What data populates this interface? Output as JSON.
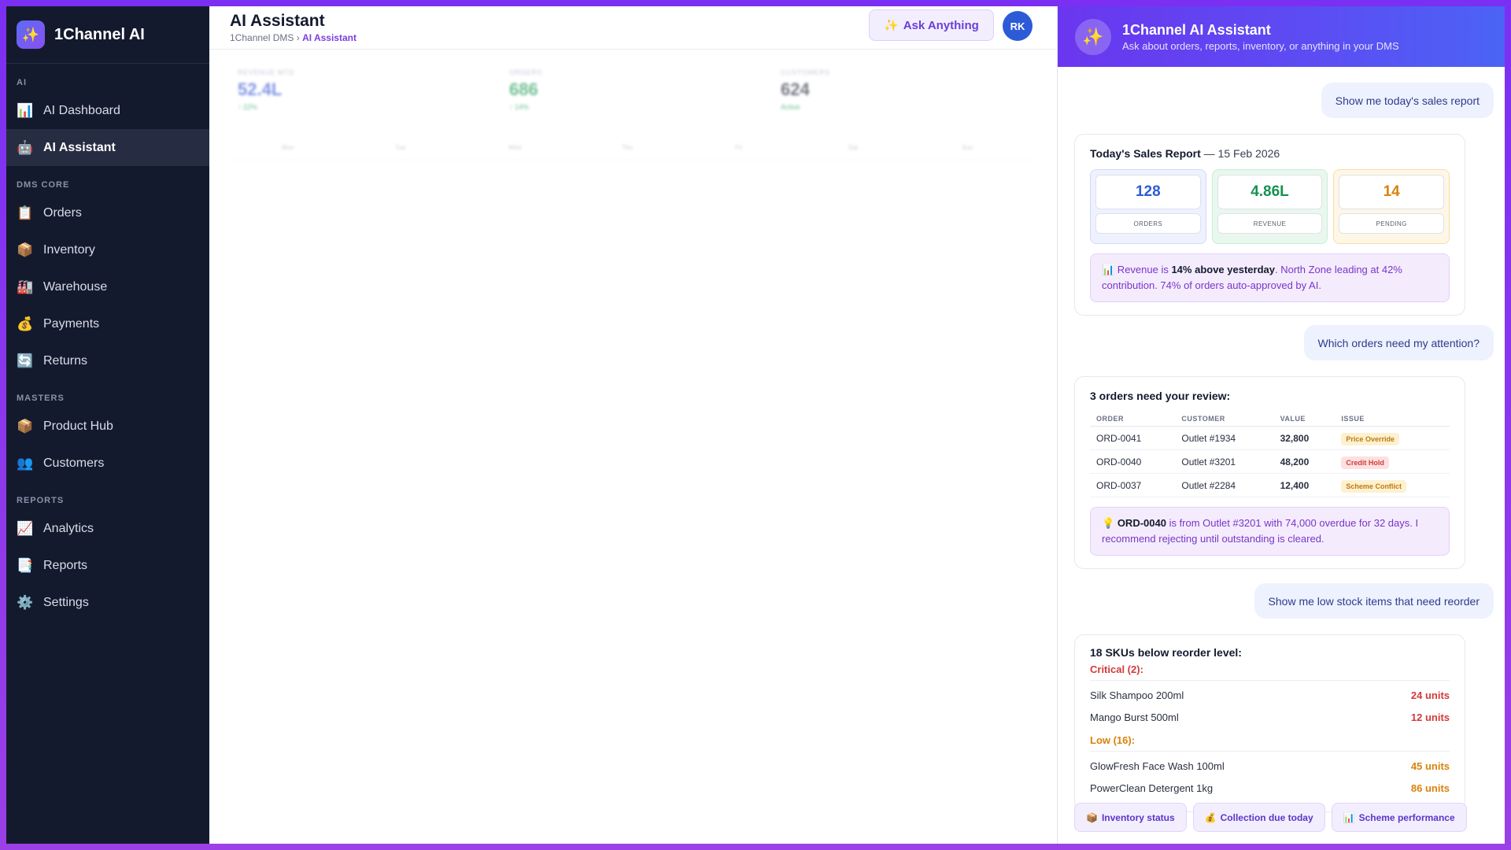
{
  "app": {
    "name": "1Channel AI",
    "logo_icon": "sparkle"
  },
  "sidebar": {
    "sections": [
      {
        "label": "AI",
        "items": [
          {
            "label": "AI Dashboard",
            "icon": "📊",
            "active": false
          },
          {
            "label": "AI Assistant",
            "icon": "🤖",
            "active": true
          }
        ]
      },
      {
        "label": "DMS CORE",
        "items": [
          {
            "label": "Orders",
            "icon": "📋"
          },
          {
            "label": "Inventory",
            "icon": "📦"
          },
          {
            "label": "Warehouse",
            "icon": "🏭"
          },
          {
            "label": "Payments",
            "icon": "💰"
          },
          {
            "label": "Returns",
            "icon": "🔄"
          }
        ]
      },
      {
        "label": "MASTERS",
        "items": [
          {
            "label": "Product Hub",
            "icon": "📦"
          },
          {
            "label": "Customers",
            "icon": "👥"
          }
        ]
      },
      {
        "label": "REPORTS",
        "items": [
          {
            "label": "Analytics",
            "icon": "📈"
          },
          {
            "label": "Reports",
            "icon": "📑"
          },
          {
            "label": "Settings",
            "icon": "⚙️"
          }
        ]
      }
    ]
  },
  "header": {
    "title": "AI Assistant",
    "breadcrumb_root": "1Channel DMS",
    "breadcrumb_sep": "›",
    "breadcrumb_current": "AI Assistant",
    "ask_button": "Ask Anything",
    "ask_icon": "✨",
    "avatar_initials": "RK"
  },
  "dashboard_bg": {
    "kpis": [
      {
        "label": "REVENUE MTD",
        "value": "52.4L",
        "sub": "↑ 22%",
        "color": "#3b5bdb"
      },
      {
        "label": "ORDERS",
        "value": "686",
        "sub": "↑ 14%",
        "color": "#1f9d57"
      },
      {
        "label": "CUSTOMERS",
        "value": "624",
        "sub": "Active",
        "color": "#2a2f40"
      }
    ],
    "axis_days": [
      "Mon",
      "Tue",
      "Wed",
      "Thu",
      "Fri",
      "Sat",
      "Sun"
    ]
  },
  "panel": {
    "title": "1Channel AI Assistant",
    "subtitle": "Ask about orders, reports, inventory, or anything in your DMS",
    "icon": "✨",
    "messages": {
      "q1": "Show me today's sales report",
      "q2": "Which orders need my attention?",
      "q3": "Show me low stock items that need reorder"
    },
    "sales_report": {
      "title": "Today's Sales Report",
      "date": " — 15 Feb 2026",
      "stats": [
        {
          "value": "128",
          "label": "ORDERS",
          "color": "#2d5bd8",
          "bg": "#eef2ff",
          "border": "#cfd9fb"
        },
        {
          "value": "4.86L",
          "label": "REVENUE",
          "color": "#15924f",
          "bg": "#e9f8ef",
          "border": "#c8ecd6"
        },
        {
          "value": "14",
          "label": "PENDING",
          "color": "#d9820b",
          "bg": "#fff7e6",
          "border": "#f6dfa6"
        }
      ],
      "insight_icon": "📊",
      "insight_a": " Revenue is ",
      "insight_b": "14% above yesterday",
      "insight_c": ". North Zone leading at 42% contribution. 74% of orders auto-approved by AI."
    },
    "orders_review": {
      "title": "3 orders need your review:",
      "columns": [
        "ORDER",
        "CUSTOMER",
        "VALUE",
        "ISSUE"
      ],
      "rows": [
        {
          "order": "ORD-0041",
          "customer": "Outlet #1934",
          "value": "32,800",
          "issue": "Price Override",
          "tone": "amber"
        },
        {
          "order": "ORD-0040",
          "customer": "Outlet #3201",
          "value": "48,200",
          "issue": "Credit Hold",
          "tone": "red"
        },
        {
          "order": "ORD-0037",
          "customer": "Outlet #2284",
          "value": "12,400",
          "issue": "Scheme Conflict",
          "tone": "amber"
        }
      ],
      "insight_icon": "💡",
      "insight_order": "ORD-0040",
      "insight_text": " is from Outlet #3201 with 74,000 overdue for 32 days. I recommend rejecting until outstanding is cleared."
    },
    "low_stock": {
      "title": "18 SKUs below reorder level:",
      "critical_label": "Critical (2):",
      "critical": [
        {
          "name": "Silk Shampoo 200ml",
          "units": "24 units"
        },
        {
          "name": "Mango Burst 500ml",
          "units": "12 units"
        }
      ],
      "low_label": "Low (16):",
      "low": [
        {
          "name": "GlowFresh Face Wash 100ml",
          "units": "45 units"
        },
        {
          "name": "PowerClean Detergent 1kg",
          "units": "86 units"
        }
      ],
      "critical_color": "#d23a3a",
      "low_color": "#d9820b"
    },
    "chips": [
      {
        "icon": "📦",
        "label": "Inventory status"
      },
      {
        "icon": "💰",
        "label": "Collection due today"
      },
      {
        "icon": "📊",
        "label": "Scheme performance"
      }
    ]
  }
}
